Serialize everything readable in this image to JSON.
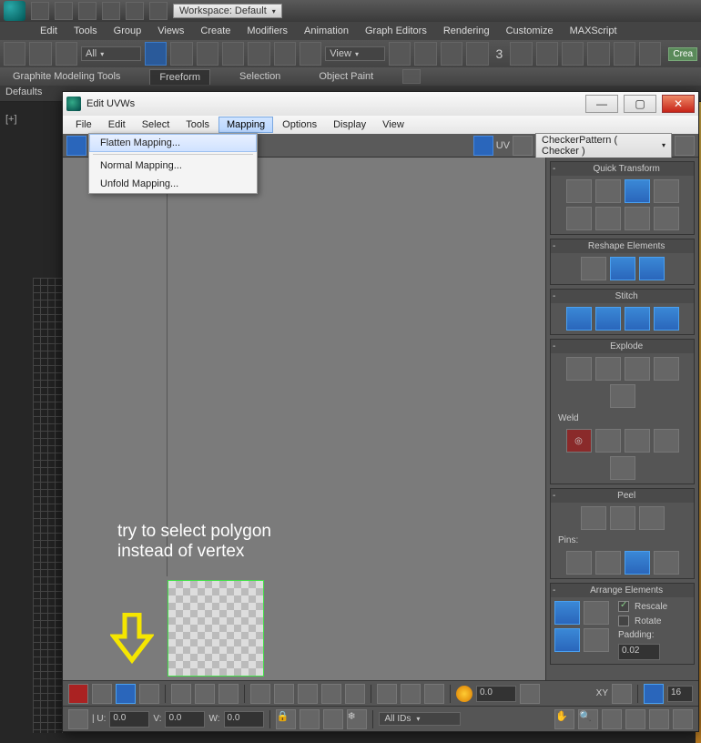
{
  "host": {
    "workspace": "Workspace: Default",
    "menu": [
      "Edit",
      "Tools",
      "Group",
      "Views",
      "Create",
      "Modifiers",
      "Animation",
      "Graph Editors",
      "Rendering",
      "Customize",
      "MAXScript"
    ],
    "ribbon_all": "All",
    "ribbon_view": "View",
    "ribbon_num": "3",
    "ribbon_tabs": [
      "Graphite Modeling Tools",
      "Freeform",
      "Selection",
      "Object Paint"
    ],
    "ribbon_active": "Freeform",
    "defaults": "Defaults",
    "create_btn": "Crea",
    "viewport_label": "[+]"
  },
  "dialog": {
    "title": "Edit UVWs",
    "menu": [
      "File",
      "Edit",
      "Select",
      "Tools",
      "Mapping",
      "Options",
      "Display",
      "View"
    ],
    "menu_active": "Mapping",
    "dropdown_items": [
      "Flatten Mapping...",
      "Normal Mapping...",
      "Unfold Mapping..."
    ],
    "uv_label": "UV",
    "texture_dropdown": "CheckerPattern  ( Checker )",
    "panels": {
      "quick_transform": "Quick Transform",
      "reshape": "Reshape Elements",
      "stitch": "Stitch",
      "explode": "Explode",
      "weld": "Weld",
      "peel": "Peel",
      "pins": "Pins:",
      "arrange": "Arrange Elements",
      "rescale": "Rescale",
      "rotate": "Rotate",
      "padding": "Padding:",
      "padding_val": "0.02"
    },
    "bottom": {
      "u_label": "| U:",
      "u_val": "0.0",
      "v_label": "V:",
      "v_val": "0.0",
      "w_label": "W:",
      "w_val": "0.0",
      "alpha_val": "0.0",
      "xy_label": "XY",
      "grid_val": "16",
      "allids": "All IDs"
    }
  },
  "annotation": {
    "line1": "try to select polygon",
    "line2": "instead of vertex"
  }
}
